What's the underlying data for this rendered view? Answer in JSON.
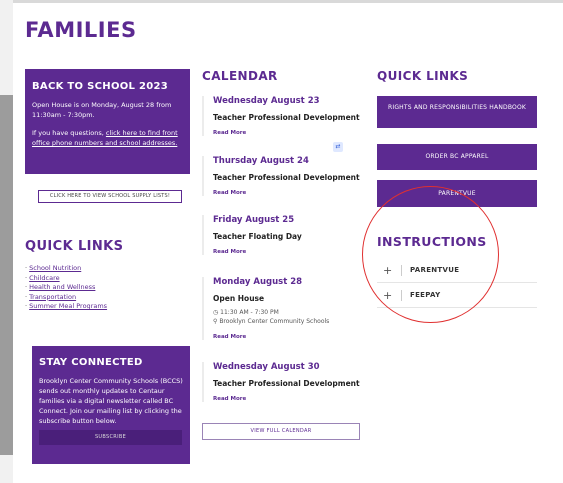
{
  "page": {
    "title": "FAMILIES"
  },
  "back_to_school": {
    "title": "BACK TO SCHOOL 2023",
    "text1": "Open House is on Monday, August 28 from 11:30am - 7:30pm.",
    "text2_prefix": "If you have questions, ",
    "text2_link": "click here to find front office phone numbers and school addresses."
  },
  "supply_button": "CLICK HERE TO VIEW SCHOOL SUPPLY LISTS!",
  "quick_links_left": {
    "title": "QUICK LINKS",
    "items": [
      "School Nutrition",
      "Childcare",
      "Health and Wellness",
      "Transportation",
      "Summer Meal Programs"
    ]
  },
  "stay_connected": {
    "title": "STAY CONNECTED",
    "text1": "Brooklyn Center Community Schools (BCCS) sends out monthly updates to Centaur families via a digital newsletter called BC Connect. Join our mailing list by clicking the subscribe button below.",
    "subscribe": "SUBSCRIBE"
  },
  "calendar": {
    "title": "CALENDAR",
    "events": [
      {
        "date": "Wednesday August 23",
        "title": "Teacher Professional Development",
        "more": "Read More"
      },
      {
        "date": "Thursday August 24",
        "title": "Teacher Professional Development",
        "more": "Read More"
      },
      {
        "date": "Friday August 25",
        "title": "Teacher Floating Day",
        "more": "Read More"
      },
      {
        "date": "Monday August 28",
        "title": "Open House",
        "time": "11:30 AM - 7:30 PM",
        "location": "Brooklyn Center Community Schools",
        "more": "Read More"
      },
      {
        "date": "Wednesday August 30",
        "title": "Teacher Professional Development",
        "more": "Read More"
      }
    ],
    "full_calendar": "VIEW FULL CALENDAR"
  },
  "quick_links_right": {
    "title": "QUICK LINKS",
    "buttons": [
      "RIGHTS AND RESPONSIBILITIES HANDBOOK",
      "ORDER BC APPAREL",
      "PARENTVUE"
    ]
  },
  "instructions": {
    "title": "INSTRUCTIONS",
    "items": [
      "PARENTVUE",
      "FEEPAY"
    ]
  },
  "icons": {
    "translate": "translate-icon",
    "clock": "clock-icon",
    "pin": "map-pin-icon",
    "plus": "plus-icon"
  },
  "colors": {
    "brand_purple": "#5c2a91",
    "annotation_red": "#e03030"
  }
}
